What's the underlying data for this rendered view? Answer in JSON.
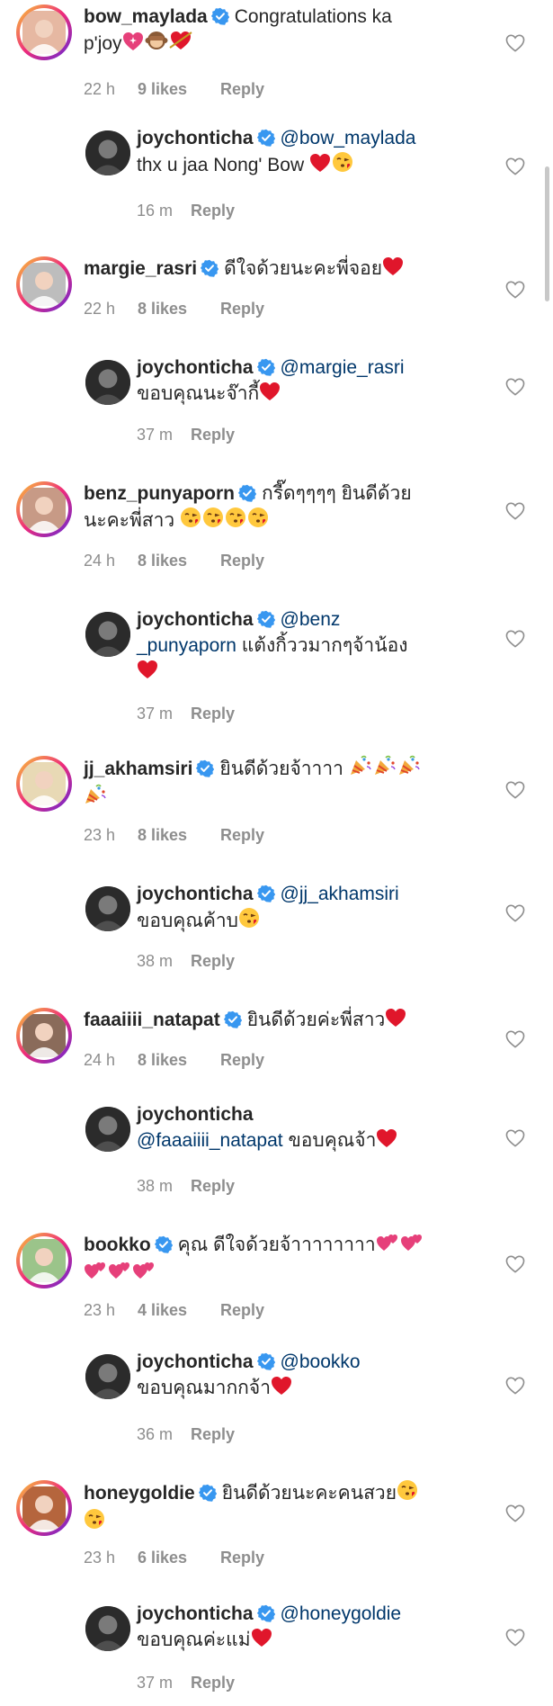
{
  "labels": {
    "reply": "Reply"
  },
  "comments": [
    {
      "username": "bow_maylada",
      "verified": true,
      "text_parts": [
        {
          "t": "Congratulations ka"
        },
        {
          "br": true
        },
        {
          "t": "p'joy"
        },
        {
          "e": "sparkle_heart"
        },
        {
          "e": "monkey"
        },
        {
          "e": "heart_arrow"
        }
      ],
      "time": "22 h",
      "likes": "9 likes",
      "is_reply": false
    },
    {
      "username": "joychonticha",
      "verified": true,
      "text_parts": [
        {
          "m": "@bow_maylada"
        },
        {
          "br": true
        },
        {
          "t": "thx u jaa Nong' Bow "
        },
        {
          "e": "red_heart"
        },
        {
          "e": "kiss"
        }
      ],
      "time": "16 m",
      "likes": "",
      "is_reply": true
    },
    {
      "username": "margie_rasri",
      "verified": true,
      "text_parts": [
        {
          "t": "ดีใจด้วยนะคะพี่จอย"
        },
        {
          "e": "red_heart"
        }
      ],
      "time": "22 h",
      "likes": "8 likes",
      "is_reply": false
    },
    {
      "username": "joychonticha",
      "verified": true,
      "text_parts": [
        {
          "m": "@margie_rasri"
        },
        {
          "br": true
        },
        {
          "t": "ขอบคุณนะจ๊ากี้"
        },
        {
          "e": "red_heart"
        }
      ],
      "time": "37 m",
      "likes": "",
      "is_reply": true
    },
    {
      "username": "benz_punyaporn",
      "verified": true,
      "text_parts": [
        {
          "t": "กรี๊ดๆๆๆๆ ยินดีด้วย"
        },
        {
          "br": true
        },
        {
          "t": "นะคะพี่สาว "
        },
        {
          "e": "kiss"
        },
        {
          "e": "kiss"
        },
        {
          "e": "kiss"
        },
        {
          "e": "kiss"
        }
      ],
      "time": "24 h",
      "likes": "8 likes",
      "is_reply": false
    },
    {
      "username": "joychonticha",
      "verified": true,
      "text_parts": [
        {
          "m": "@benz"
        },
        {
          "br": true
        },
        {
          "m": "_punyaporn"
        },
        {
          "t": " แต้งกิ้ววมากๆจ้าน้อง"
        },
        {
          "br": true
        },
        {
          "e": "red_heart"
        }
      ],
      "time": "37 m",
      "likes": "",
      "is_reply": true
    },
    {
      "username": "jj_akhamsiri",
      "verified": true,
      "text_parts": [
        {
          "t": "ยินดีด้วยจ้าาาา "
        },
        {
          "e": "party"
        },
        {
          "e": "party"
        },
        {
          "e": "party"
        },
        {
          "br": true
        },
        {
          "e": "party"
        }
      ],
      "time": "23 h",
      "likes": "8 likes",
      "is_reply": false
    },
    {
      "username": "joychonticha",
      "verified": true,
      "text_parts": [
        {
          "m": "@jj_akhamsiri"
        },
        {
          "br": true
        },
        {
          "t": "ขอบคุณค้าบ"
        },
        {
          "e": "kiss"
        }
      ],
      "time": "38 m",
      "likes": "",
      "is_reply": true
    },
    {
      "username": "faaaiiii_natapat",
      "verified": true,
      "text_parts": [
        {
          "t": "ยินดีด้วยค่ะพี่สาว"
        },
        {
          "e": "red_heart"
        }
      ],
      "time": "24 h",
      "likes": "8 likes",
      "is_reply": false
    },
    {
      "username": "joychonticha",
      "verified": false,
      "text_parts": [
        {
          "br": true
        },
        {
          "m": "@faaaiiii_natapat"
        },
        {
          "t": " ขอบคุณจ้า"
        },
        {
          "e": "red_heart"
        }
      ],
      "time": "38 m",
      "likes": "",
      "is_reply": true
    },
    {
      "username": "bookko",
      "verified": true,
      "text_parts": [
        {
          "t": "คุณ ดีใจด้วยจ้าาาาาาาา"
        },
        {
          "e": "two_hearts"
        },
        {
          "e": "two_hearts"
        },
        {
          "br": true
        },
        {
          "e": "two_hearts"
        },
        {
          "e": "two_hearts"
        },
        {
          "e": "two_hearts"
        }
      ],
      "time": "23 h",
      "likes": "4 likes",
      "is_reply": false
    },
    {
      "username": "joychonticha",
      "verified": true,
      "text_parts": [
        {
          "m": "@bookko"
        },
        {
          "br": true
        },
        {
          "t": "ขอบคุณมากกจ้า"
        },
        {
          "e": "red_heart"
        }
      ],
      "time": "36 m",
      "likes": "",
      "is_reply": true
    },
    {
      "username": "honeygoldie",
      "verified": true,
      "text_parts": [
        {
          "t": "ยินดีด้วยนะคะคนสวย"
        },
        {
          "e": "kiss"
        },
        {
          "br": true
        },
        {
          "e": "kiss"
        }
      ],
      "time": "23 h",
      "likes": "6 likes",
      "is_reply": false
    },
    {
      "username": "joychonticha",
      "verified": true,
      "text_parts": [
        {
          "m": "@honeygoldie"
        },
        {
          "br": true
        },
        {
          "t": "ขอบคุณค่ะแม่"
        },
        {
          "e": "red_heart"
        }
      ],
      "time": "37 m",
      "likes": "",
      "is_reply": true
    }
  ]
}
